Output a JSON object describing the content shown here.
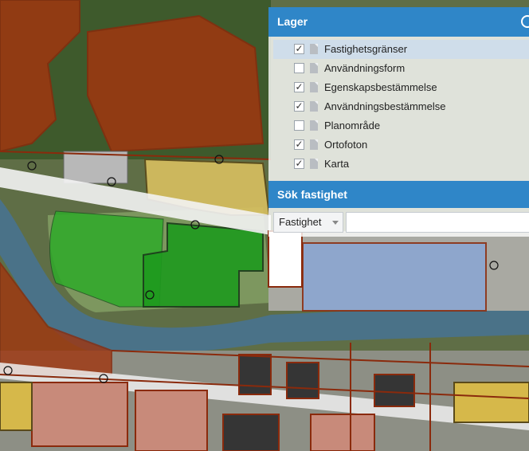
{
  "panel": {
    "layers_title": "Lager",
    "layers": [
      {
        "label": "Fastighetsgränser",
        "checked": true,
        "active": true
      },
      {
        "label": "Användningsform",
        "checked": false,
        "active": false
      },
      {
        "label": "Egenskapsbestämmelse",
        "checked": true,
        "active": false
      },
      {
        "label": "Användningsbestämmelse",
        "checked": true,
        "active": false
      },
      {
        "label": "Planområde",
        "checked": false,
        "active": false
      },
      {
        "label": "Ortofoton",
        "checked": true,
        "active": false
      },
      {
        "label": "Karta",
        "checked": true,
        "active": false
      }
    ],
    "search_title": "Sök fastighet",
    "search_type": "Fastighet",
    "search_value": ""
  },
  "colors": {
    "header": "#2f86c8",
    "parcel_line": "#8a2a0c",
    "red_zone": "#a0360f",
    "green_zone": "#2faa2a",
    "yellow_zone": "#d8c060",
    "blue_zone": "#8aa6d4"
  }
}
